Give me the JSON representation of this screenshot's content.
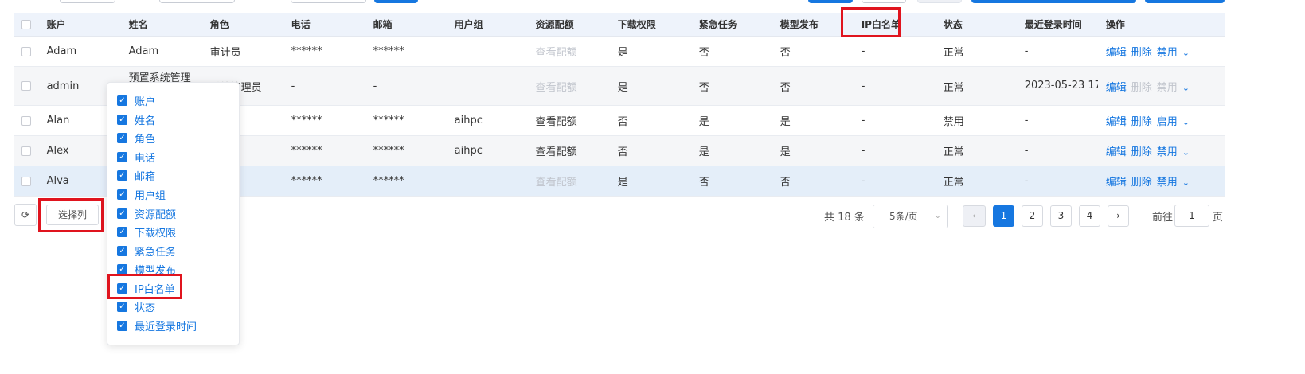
{
  "table": {
    "headers": [
      "账户",
      "姓名",
      "角色",
      "电话",
      "邮箱",
      "用户组",
      "资源配额",
      "下载权限",
      "紧急任务",
      "模型发布",
      "IP白名单",
      "状态",
      "最近登录时间",
      "操作"
    ],
    "rows": [
      {
        "account": "Adam",
        "name": "Adam",
        "role": "审计员",
        "phone": "******",
        "email": "******",
        "group": "",
        "quota": "查看配额",
        "download": "是",
        "urgent": "否",
        "publish": "否",
        "ip": "-",
        "status": "正常",
        "last_login": "-",
        "edit": "编辑",
        "delete": "删除",
        "toggle": "禁用"
      },
      {
        "account": "admin",
        "name": "预置系统管理",
        "role": "系统管理员",
        "phone": "-",
        "email": "-",
        "group": "",
        "quota": "查看配额",
        "download": "是",
        "urgent": "否",
        "publish": "否",
        "ip": "-",
        "status": "正常",
        "last_login": "2023-05-23 17:09:50",
        "edit": "编辑",
        "delete": "删除",
        "toggle": "禁用"
      },
      {
        "account": "Alan",
        "name": "",
        "role": "管理员",
        "phone": "******",
        "email": "******",
        "group": "aihpc",
        "quota": "查看配额",
        "download": "否",
        "urgent": "是",
        "publish": "是",
        "ip": "-",
        "status": "禁用",
        "last_login": "-",
        "edit": "编辑",
        "delete": "删除",
        "toggle": "启用"
      },
      {
        "account": "Alex",
        "name": "",
        "role": "用户",
        "phone": "******",
        "email": "******",
        "group": "aihpc",
        "quota": "查看配额",
        "download": "否",
        "urgent": "是",
        "publish": "是",
        "ip": "-",
        "status": "正常",
        "last_login": "-",
        "edit": "编辑",
        "delete": "删除",
        "toggle": "禁用"
      },
      {
        "account": "Alva",
        "name": "",
        "role": "管理员",
        "phone": "******",
        "email": "******",
        "group": "",
        "quota": "查看配额",
        "download": "是",
        "urgent": "否",
        "publish": "否",
        "ip": "-",
        "status": "正常",
        "last_login": "-",
        "edit": "编辑",
        "delete": "删除",
        "toggle": "禁用"
      }
    ]
  },
  "footer": {
    "choose_columns": "选择列",
    "refresh_icon": "refresh-icon",
    "total": "共 18 条",
    "page_size": "5条/页",
    "pages": [
      "1",
      "2",
      "3",
      "4"
    ],
    "current_page": "1",
    "goto_label": "前往",
    "goto_value": "1",
    "page_suffix": "页"
  },
  "column_picker": {
    "options": [
      "账户",
      "姓名",
      "角色",
      "电话",
      "邮箱",
      "用户组",
      "资源配额",
      "下载权限",
      "紧急任务",
      "模型发布",
      "IP白名单",
      "状态",
      "最近登录时间"
    ]
  },
  "colors": {
    "accent": "#1677e0",
    "highlight": "#e0141e",
    "header_bg": "#eef3fb"
  }
}
